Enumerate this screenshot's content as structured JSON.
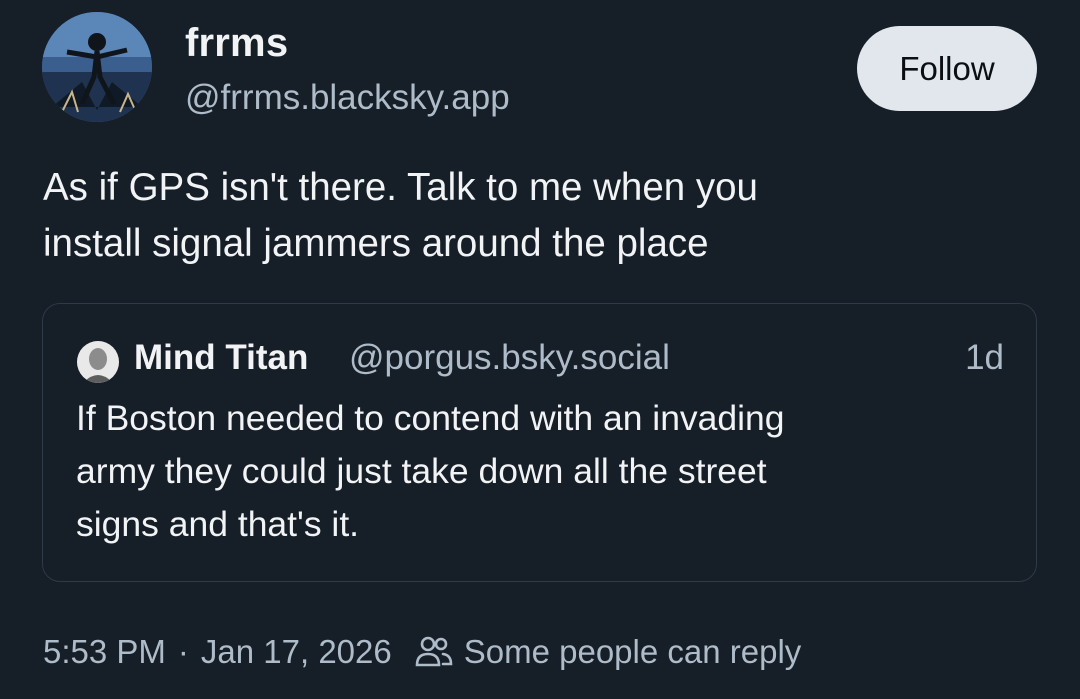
{
  "author": {
    "display_name": "frrms",
    "handle": "@frrms.blacksky.app",
    "avatar_icon": "avatar-artwork"
  },
  "follow_label": "Follow",
  "post": {
    "text_line1": "As if GPS isn't there. Talk to me when you",
    "text_line2": "install signal jammers around the place"
  },
  "quote": {
    "display_name": "Mind Titan",
    "handle": "@porgus.bsky.social",
    "time_ago": "1d",
    "text_line1": "If Boston needed to contend with an invading",
    "text_line2": "army they could just take down all the street",
    "text_line3": "signs and that's it."
  },
  "meta": {
    "time": "5:53 PM",
    "separator": "·",
    "date": "Jan 17, 2026",
    "reply_icon": "people-icon",
    "reply_setting": "Some people can reply"
  },
  "colors": {
    "background": "#161e27",
    "text_primary": "#f1f3f5",
    "text_secondary": "#aebbc9",
    "follow_button_bg": "#e2e7ee",
    "card_border": "#2e3a48"
  }
}
